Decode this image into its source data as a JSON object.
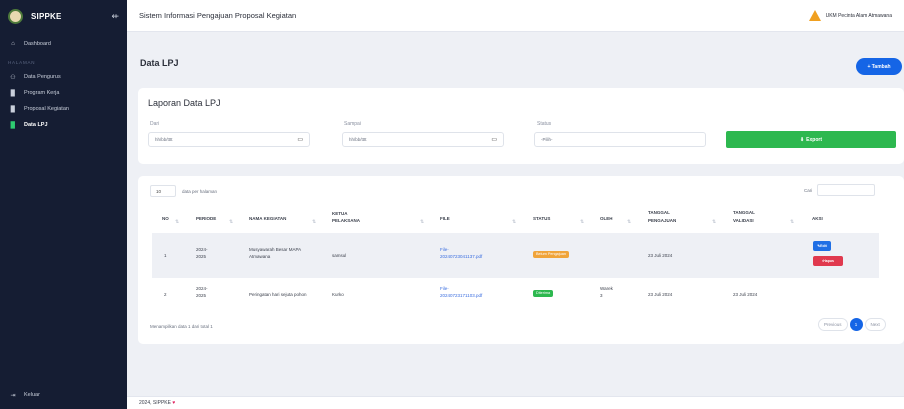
{
  "sidebar": {
    "brand": "SIPPKE",
    "heading": "HALAMAN",
    "items": [
      {
        "label": "Dashboard",
        "icon": "home-icon"
      },
      {
        "label": "Data Pengurus",
        "icon": "users-icon"
      },
      {
        "label": "Program Kerja",
        "icon": "file-icon"
      },
      {
        "label": "Proposal Kegiatan",
        "icon": "file-icon"
      },
      {
        "label": "Data LPJ",
        "icon": "file-icon"
      }
    ],
    "logout": "Keluar"
  },
  "topbar": {
    "title": "Sistem Informasi Pengajuan Proposal Kegiatan",
    "user": "UKM Pecinta Alam Atmawana"
  },
  "page": {
    "title": "Data LPJ",
    "add_label": "+ Tambah"
  },
  "filter": {
    "card_title": "Laporan Data LPJ",
    "from_label": "Dari",
    "from_value": "hh/bb/tttt",
    "to_label": "Sampai",
    "to_value": "hh/bb/tttt",
    "status_label": "Status",
    "status_value": "-Pilih-",
    "export_label": "Export"
  },
  "table": {
    "per_page_value": "10",
    "per_page_label": "data per halaman",
    "search_label": "Cari",
    "headers": {
      "no": "NO",
      "periode": "PERIODE",
      "nama": "NAMA KEGIATAN",
      "ketua_1": "KETUA",
      "ketua_2": "PELAKSANA",
      "file": "FILE",
      "status": "STATUS",
      "oleh": "OLEH",
      "tgl_peng_1": "TANGGAL",
      "tgl_peng_2": "PENGAJUAN",
      "tgl_val_1": "TANGGAL",
      "tgl_val_2": "VALIDASI",
      "aksi": "AKSI"
    },
    "rows": [
      {
        "no": "1",
        "periode_1": "2024-",
        "periode_2": "2025",
        "nama_1": "Musyawarah Besar MAPA",
        "nama_2": "Atmawana",
        "ketua": "samsul",
        "file_1": "File-",
        "file_2": "20240723041137.pdf",
        "status": "Belum Pengajuan",
        "oleh_1": "",
        "oleh_2": "",
        "tgl_pengajuan": "23 Juli 2024",
        "tgl_validasi": "",
        "edit": "Edit",
        "hapus": "Hapus"
      },
      {
        "no": "2",
        "periode_1": "2024-",
        "periode_2": "2025",
        "nama_1": "Peringatan hari sejuta pohon",
        "nama_2": "",
        "ketua": "Kurko",
        "file_1": "File-",
        "file_2": "20240723171103.pdf",
        "status": "Diterima",
        "oleh_1": "Warek",
        "oleh_2": "3",
        "tgl_pengajuan": "23 Juli 2024",
        "tgl_validasi": "23 Juli 2024"
      }
    ],
    "showing": "Menampilkan data 1 dari total 1",
    "pager": {
      "prev": "Previous",
      "current": "1",
      "next": "Next"
    }
  },
  "footer": {
    "text": "2024, SIPPKE"
  },
  "colors": {
    "sidebar": "#151d33",
    "primary": "#1565e6",
    "success": "#2db84f",
    "warning": "#f0a43a",
    "danger": "#e0394e",
    "info": "#1f6fe5"
  }
}
